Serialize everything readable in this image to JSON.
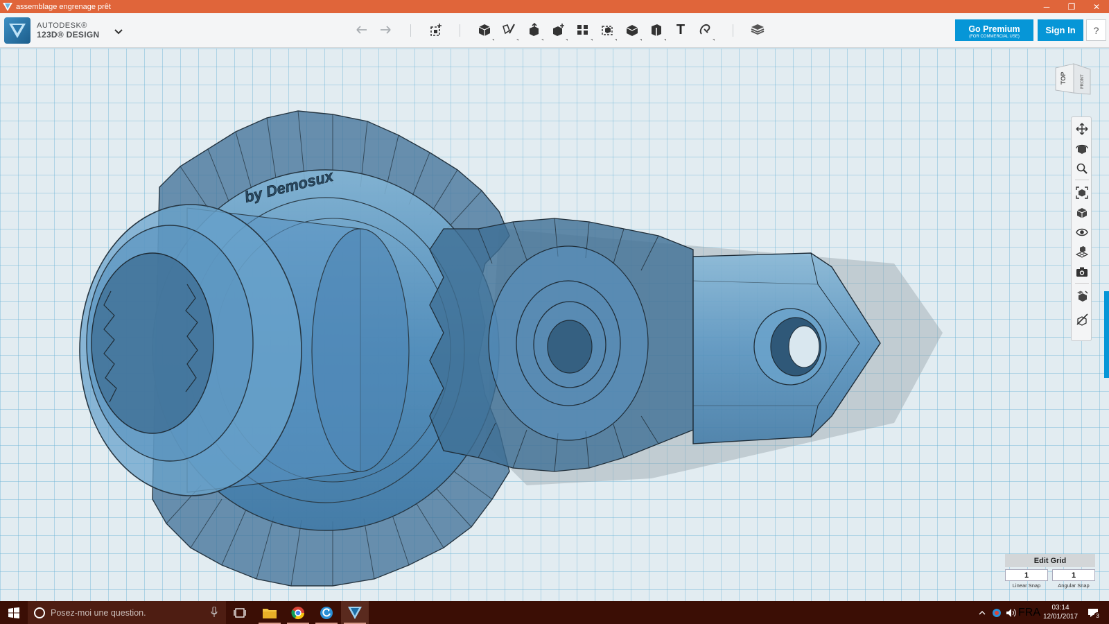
{
  "window": {
    "title": "assemblage engrenage prêt",
    "controls": {
      "minimize": "─",
      "restore": "❐",
      "close": "✕"
    }
  },
  "brand": {
    "line1": "AUTODESK®",
    "line2": "123D® DESIGN"
  },
  "toolbar": {
    "tools": [
      {
        "name": "undo-icon"
      },
      {
        "name": "redo-icon"
      },
      {
        "name": "transform-icon"
      },
      {
        "name": "primitives-icon"
      },
      {
        "name": "sketch-icon"
      },
      {
        "name": "construct-icon"
      },
      {
        "name": "modify-icon"
      },
      {
        "name": "pattern-icon"
      },
      {
        "name": "grouping-icon"
      },
      {
        "name": "combine-icon"
      },
      {
        "name": "measure-icon"
      },
      {
        "name": "text-icon"
      },
      {
        "name": "snap-icon"
      },
      {
        "name": "material-icon"
      }
    ],
    "text_tool_glyph": "T"
  },
  "account": {
    "premium_label": "Go Premium",
    "premium_sub": "(FOR COMMERCIAL USE)",
    "signin_label": "Sign In",
    "help_label": "?"
  },
  "viewcube": {
    "top": "TOP",
    "front": "FRONT"
  },
  "model": {
    "engraved_text": "by Demosux"
  },
  "edit_grid": {
    "title": "Edit Grid",
    "linear_snap_value": "1",
    "angular_snap_value": "1",
    "linear_snap_label": "Linear Snap",
    "angular_snap_label": "Angular Snap"
  },
  "taskbar": {
    "search_placeholder": "Posez-moi une question.",
    "language": "FRA",
    "time": "03:14",
    "date": "12/01/2017",
    "notification_count": "3"
  },
  "colors": {
    "titlebar": "#e0653a",
    "accent": "#0696d7",
    "taskbar": "#3b0e05",
    "model_fill": "#4f8fbf"
  }
}
